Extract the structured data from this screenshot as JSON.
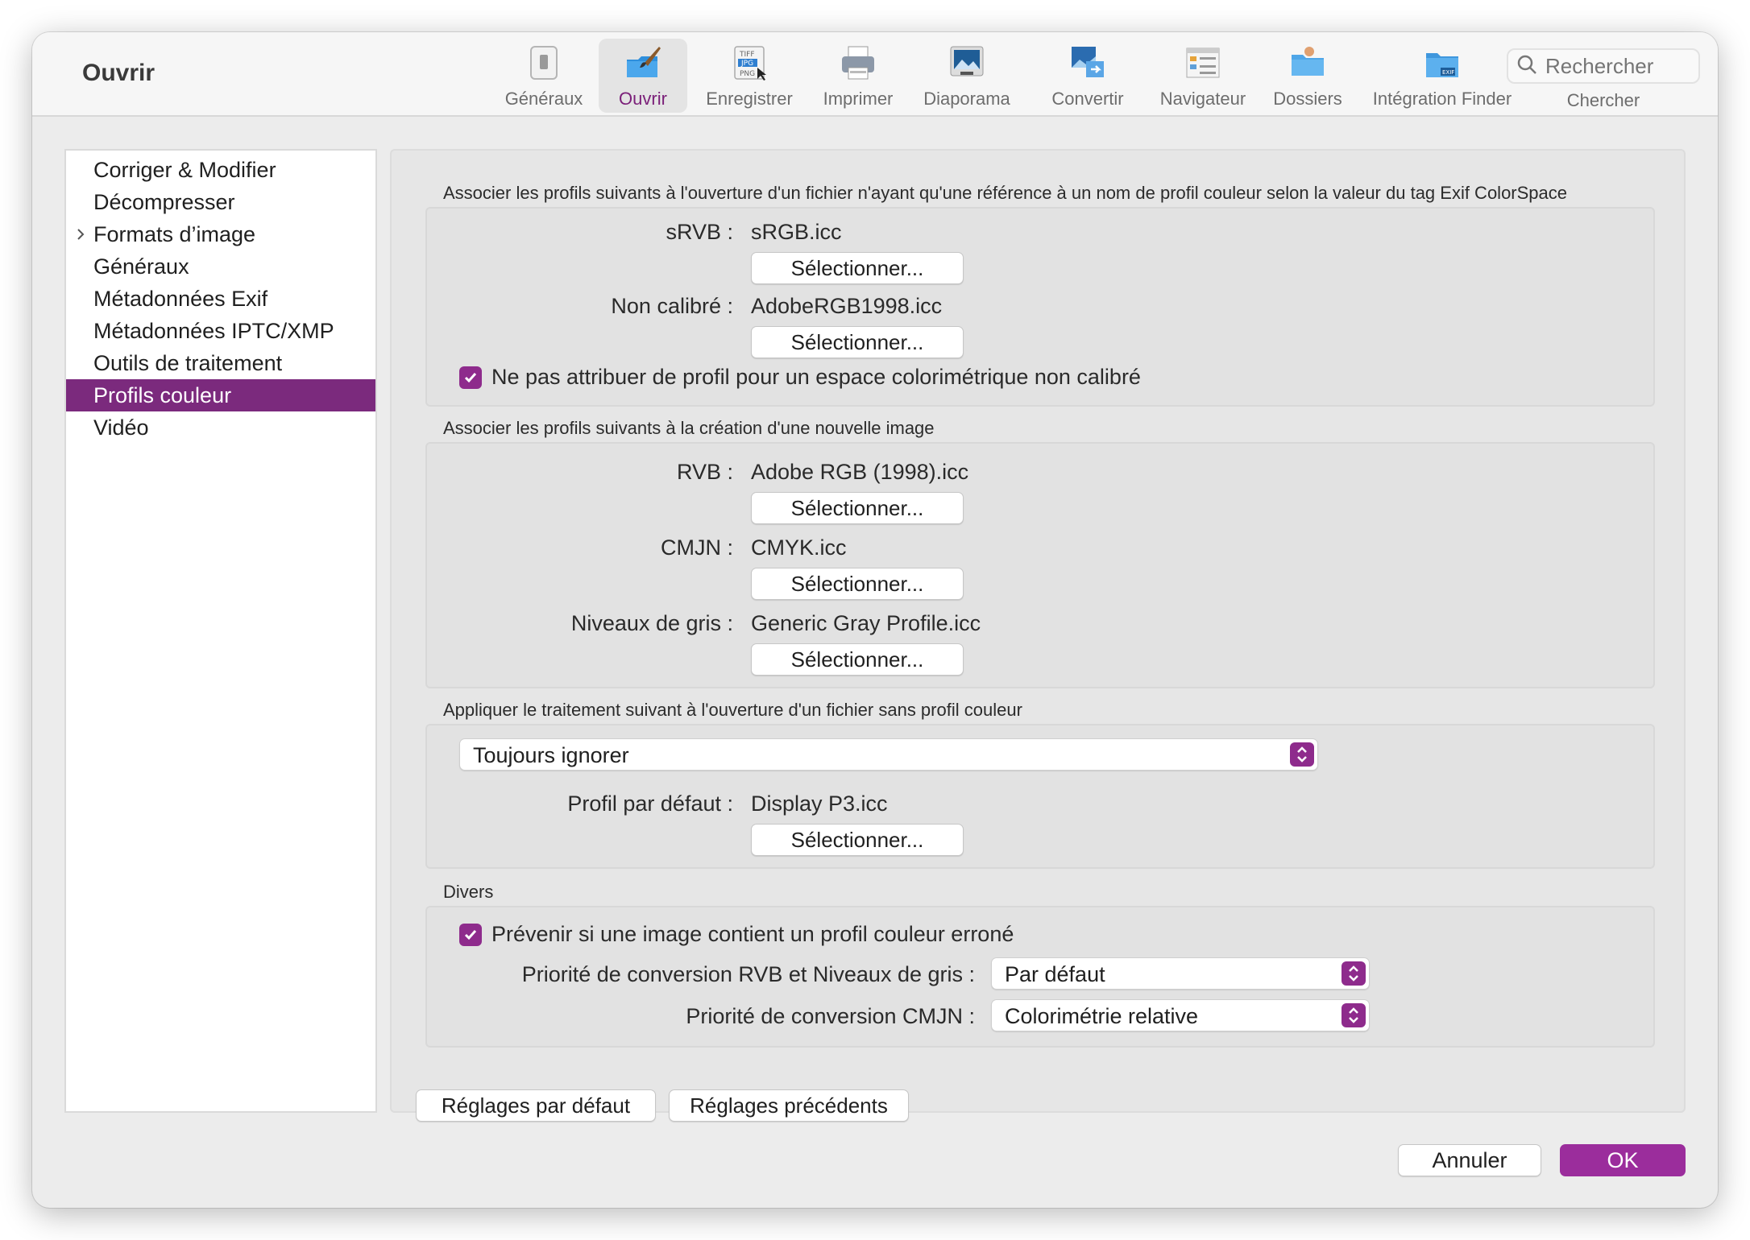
{
  "window": {
    "title": "Ouvrir"
  },
  "toolbar": {
    "items": [
      {
        "label": "Généraux",
        "icon": "switch-icon"
      },
      {
        "label": "Ouvrir",
        "icon": "paintbrush-icon",
        "active": true
      },
      {
        "label": "Enregistrer",
        "icon": "file-formats-icon"
      },
      {
        "label": "Imprimer",
        "icon": "printer-icon"
      },
      {
        "label": "Diaporama",
        "icon": "slideshow-icon"
      },
      {
        "label": "Convertir",
        "icon": "convert-icon"
      },
      {
        "label": "Navigateur",
        "icon": "browser-icon"
      },
      {
        "label": "Dossiers",
        "icon": "folder-icon"
      },
      {
        "label": "Intégration Finder",
        "icon": "finder-folder-icon"
      }
    ],
    "search": {
      "placeholder": "Rechercher",
      "label": "Chercher"
    }
  },
  "sidebar": {
    "items": [
      {
        "label": "Corriger & Modifier"
      },
      {
        "label": "Décompresser"
      },
      {
        "label": "Formats d’image",
        "expandable": true
      },
      {
        "label": "Généraux"
      },
      {
        "label": "Métadonnées Exif"
      },
      {
        "label": "Métadonnées IPTC/XMP"
      },
      {
        "label": "Outils de traitement"
      },
      {
        "label": "Profils couleur",
        "selected": true
      },
      {
        "label": "Vidéo"
      }
    ]
  },
  "exif_section": {
    "title": "Associer les profils suivants à l'ouverture d'un fichier n'ayant qu'une référence à un nom de profil couleur selon la valeur du tag Exif ColorSpace",
    "srgb_label": "sRVB :",
    "srgb_value": "sRGB.icc",
    "uncal_label": "Non calibré :",
    "uncal_value": "AdobeRGB1998.icc",
    "checkbox_label": "Ne pas attribuer de profil pour un espace colorimétrique non calibré",
    "checkbox_checked": true
  },
  "new_image_section": {
    "title": "Associer les profils suivants à la création d'une nouvelle image",
    "rgb_label": "RVB :",
    "rgb_value": "Adobe RGB (1998).icc",
    "cmyk_label": "CMJN :",
    "cmyk_value": "CMYK.icc",
    "gray_label": "Niveaux de gris :",
    "gray_value": "Generic Gray Profile.icc"
  },
  "no_profile_section": {
    "title": "Appliquer le traitement suivant à l'ouverture d'un fichier sans profil couleur",
    "select_value": "Toujours ignorer",
    "default_label": "Profil par défaut :",
    "default_value": "Display P3.icc"
  },
  "misc_section": {
    "title": "Divers",
    "warn_label": "Prévenir si une image contient un profil couleur erroné",
    "warn_checked": true,
    "rgb_priority_label": "Priorité de conversion RVB et Niveaux de gris :",
    "rgb_priority_value": "Par défaut",
    "cmyk_priority_label": "Priorité de conversion CMJN :",
    "cmyk_priority_value": "Colorimétrie relative"
  },
  "buttons": {
    "select": "Sélectionner...",
    "defaults": "Réglages par défaut",
    "previous": "Réglages précédents",
    "cancel": "Annuler",
    "ok": "OK"
  },
  "colors": {
    "accent": "#8e2b8c",
    "sidebar_selected": "#7b2a7d",
    "ok_button": "#9b2d9c"
  }
}
